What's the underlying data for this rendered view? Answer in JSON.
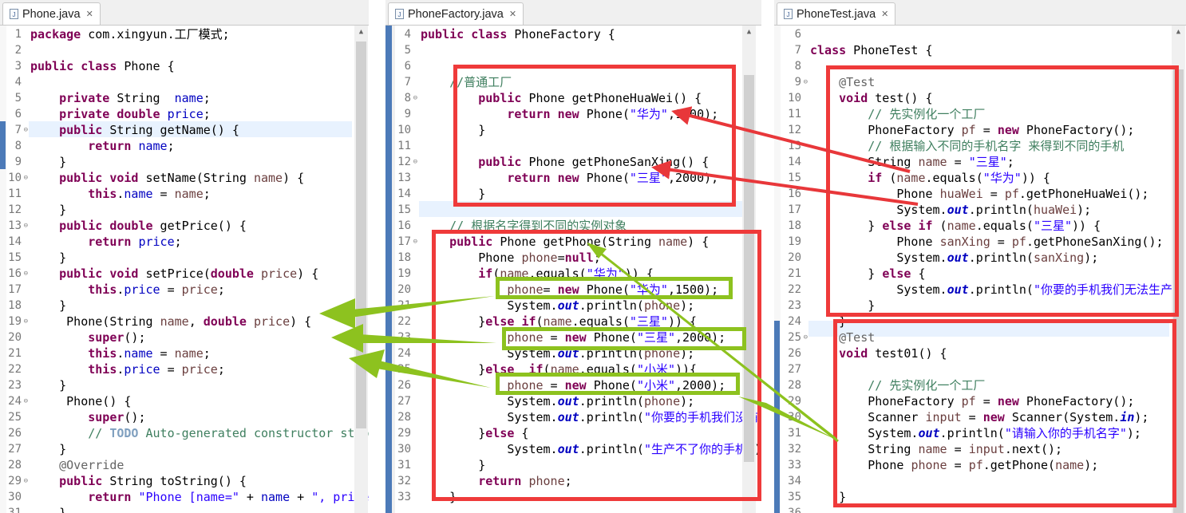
{
  "editors": [
    {
      "tab_title": "Phone.java",
      "code_lines": [
        {
          "num": "1",
          "html": "<span class=\"k\">package</span> com.xingyun.工厂模式;"
        },
        {
          "num": "2",
          "html": ""
        },
        {
          "num": "3",
          "html": "<span class=\"k\">public</span> <span class=\"k\">class</span> Phone {"
        },
        {
          "num": "4",
          "html": ""
        },
        {
          "num": "5",
          "html": "    <span class=\"k\">private</span> String  <span class=\"f\">name</span>;"
        },
        {
          "num": "6",
          "html": "    <span class=\"k\">private</span> <span class=\"k\">double</span> <span class=\"f\">price</span>;"
        },
        {
          "num": "7",
          "html": "    <span class=\"k\">public</span> String getName() {"
        },
        {
          "num": "8",
          "html": "        <span class=\"k\">return</span> <span class=\"f\">name</span>;"
        },
        {
          "num": "9",
          "html": "    }"
        },
        {
          "num": "10",
          "html": "    <span class=\"k\">public</span> <span class=\"k\">void</span> setName(String <span class=\"var\">name</span>) {"
        },
        {
          "num": "11",
          "html": "        <span class=\"k\">this</span>.<span class=\"f\">name</span> = <span class=\"var\">name</span>;"
        },
        {
          "num": "12",
          "html": "    }"
        },
        {
          "num": "13",
          "html": "    <span class=\"k\">public</span> <span class=\"k\">double</span> getPrice() {"
        },
        {
          "num": "14",
          "html": "        <span class=\"k\">return</span> <span class=\"f\">price</span>;"
        },
        {
          "num": "15",
          "html": "    }"
        },
        {
          "num": "16",
          "html": "    <span class=\"k\">public</span> <span class=\"k\">void</span> setPrice(<span class=\"k\">double</span> <span class=\"var\">price</span>) {"
        },
        {
          "num": "17",
          "html": "        <span class=\"k\">this</span>.<span class=\"f\">price</span> = <span class=\"var\">price</span>;"
        },
        {
          "num": "18",
          "html": "    }"
        },
        {
          "num": "19",
          "html": "     Phone(String <span class=\"var\">name</span>, <span class=\"k\">double</span> <span class=\"var\">price</span>) {"
        },
        {
          "num": "20",
          "html": "        <span class=\"k\">super</span>();"
        },
        {
          "num": "21",
          "html": "        <span class=\"k\">this</span>.<span class=\"f\">name</span> = <span class=\"var\">name</span>;"
        },
        {
          "num": "22",
          "html": "        <span class=\"k\">this</span>.<span class=\"f\">price</span> = <span class=\"var\">price</span>;"
        },
        {
          "num": "23",
          "html": "    }"
        },
        {
          "num": "24",
          "html": "     Phone() {"
        },
        {
          "num": "25",
          "html": "        <span class=\"k\">super</span>();"
        },
        {
          "num": "26",
          "html": "        <span class=\"c\">// <span class=\"tag\">TODO</span> Auto-generated constructor stub</span>"
        },
        {
          "num": "27",
          "html": "    }"
        },
        {
          "num": "28",
          "html": "    <span class=\"an\">@Override</span>"
        },
        {
          "num": "29",
          "html": "    <span class=\"k\">public</span> String toString() {"
        },
        {
          "num": "30",
          "html": "        <span class=\"k\">return</span> <span class=\"s\">\"Phone [name=\"</span> + <span class=\"f\">name</span> + <span class=\"s\">\", price=\"</span> + <span class=\"f\">price</span> + <span class=\"s\">\"]\"</span>;"
        },
        {
          "num": "31",
          "html": "    }"
        }
      ]
    },
    {
      "tab_title": "PhoneFactory.java",
      "code_lines": [
        {
          "num": "4",
          "html": "<span class=\"k\">public</span> <span class=\"k\">class</span> PhoneFactory {"
        },
        {
          "num": "5",
          "html": ""
        },
        {
          "num": "6",
          "html": ""
        },
        {
          "num": "7",
          "html": "    <span class=\"c\">//普通工厂</span>"
        },
        {
          "num": "8",
          "html": "        <span class=\"k\">public</span> Phone getPhoneHuaWei() {"
        },
        {
          "num": "9",
          "html": "            <span class=\"k\">return</span> <span class=\"k\">new</span> Phone(<span class=\"s\">\"华为\"</span>,1500);"
        },
        {
          "num": "10",
          "html": "        }"
        },
        {
          "num": "11",
          "html": ""
        },
        {
          "num": "12",
          "html": "        <span class=\"k\">public</span> Phone getPhoneSanXing() {"
        },
        {
          "num": "13",
          "html": "            <span class=\"k\">return</span> <span class=\"k\">new</span> Phone(<span class=\"s\">\"三星\"</span>,2000);"
        },
        {
          "num": "14",
          "html": "        }"
        },
        {
          "num": "15",
          "html": ""
        },
        {
          "num": "16",
          "html": "    <span class=\"c\">// 根据名字得到不同的实例对象</span>"
        },
        {
          "num": "17",
          "html": "    <span class=\"k\">public</span> Phone getPhone(String <span class=\"var\">name</span>) {"
        },
        {
          "num": "18",
          "html": "        Phone <span class=\"var\">phone</span>=<span class=\"k\">null</span>;"
        },
        {
          "num": "19",
          "html": "        <span class=\"k\">if</span>(<span class=\"var\">name</span>.equals(<span class=\"s\">\"华为\"</span>)) {"
        },
        {
          "num": "20",
          "html": "            <span class=\"var\">phone</span>= <span class=\"k\">new</span> Phone(<span class=\"s\">\"华为\"</span>,1500);"
        },
        {
          "num": "21",
          "html": "            System.<span class=\"so\">out</span>.println(<span class=\"var\">phone</span>);"
        },
        {
          "num": "22",
          "html": "        }<span class=\"k\">else</span> <span class=\"k\">if</span>(<span class=\"var\">name</span>.equals(<span class=\"s\">\"三星\"</span>)) {"
        },
        {
          "num": "23",
          "html": "            <span class=\"var\">phone</span> = <span class=\"k\">new</span> Phone(<span class=\"s\">\"三星\"</span>,2000);"
        },
        {
          "num": "24",
          "html": "            System.<span class=\"so\">out</span>.println(<span class=\"var\">phone</span>);"
        },
        {
          "num": "25",
          "html": "        }<span class=\"k\">else</span>  <span class=\"k\">if</span>(<span class=\"var\">name</span>.equals(<span class=\"s\">\"小米\"</span>)){"
        },
        {
          "num": "26",
          "html": "            <span class=\"var\">phone</span> = <span class=\"k\">new</span> Phone(<span class=\"s\">\"小米\"</span>,2000);"
        },
        {
          "num": "27",
          "html": "            System.<span class=\"so\">out</span>.println(<span class=\"var\">phone</span>);"
        },
        {
          "num": "28",
          "html": "            System.<span class=\"so\">out</span>.println(<span class=\"s\">\"你要的手机我们没有\"</span>);"
        },
        {
          "num": "29",
          "html": "        }<span class=\"k\">else</span> {"
        },
        {
          "num": "30",
          "html": "            System.<span class=\"so\">out</span>.println(<span class=\"s\">\"生产不了你的手机\"</span>);"
        },
        {
          "num": "31",
          "html": "        }"
        },
        {
          "num": "32",
          "html": "        <span class=\"k\">return</span> <span class=\"var\">phone</span>;"
        },
        {
          "num": "33",
          "html": "    }"
        }
      ]
    },
    {
      "tab_title": "PhoneTest.java",
      "code_lines": [
        {
          "num": "6",
          "html": ""
        },
        {
          "num": "7",
          "html": "<span class=\"k\">class</span> PhoneTest {"
        },
        {
          "num": "8",
          "html": ""
        },
        {
          "num": "9",
          "html": "    <span class=\"an\">@Test</span>"
        },
        {
          "num": "10",
          "html": "    <span class=\"k\">void</span> test() {"
        },
        {
          "num": "11",
          "html": "        <span class=\"c\">// 先实例化一个工厂</span>"
        },
        {
          "num": "12",
          "html": "        PhoneFactory <span class=\"var\">pf</span> = <span class=\"k\">new</span> PhoneFactory();"
        },
        {
          "num": "13",
          "html": "        <span class=\"c\">// 根据输入不同的手机名字 来得到不同的手机</span>"
        },
        {
          "num": "14",
          "html": "        String <span class=\"var\">name</span> = <span class=\"s\">\"三星\"</span>;"
        },
        {
          "num": "15",
          "html": "        <span class=\"k\">if</span> (<span class=\"var\">name</span>.equals(<span class=\"s\">\"华为\"</span>)) {"
        },
        {
          "num": "16",
          "html": "            Phone <span class=\"var\">huaWei</span> = <span class=\"var\">pf</span>.getPhoneHuaWei();"
        },
        {
          "num": "17",
          "html": "            System.<span class=\"so\">out</span>.println(<span class=\"var\">huaWei</span>);"
        },
        {
          "num": "18",
          "html": "        } <span class=\"k\">else</span> <span class=\"k\">if</span> (<span class=\"var\">name</span>.equals(<span class=\"s\">\"三星\"</span>)) {"
        },
        {
          "num": "19",
          "html": "            Phone <span class=\"var\">sanXing</span> = <span class=\"var\">pf</span>.getPhoneSanXing();"
        },
        {
          "num": "20",
          "html": "            System.<span class=\"so\">out</span>.println(<span class=\"var\">sanXing</span>);"
        },
        {
          "num": "21",
          "html": "        } <span class=\"k\">else</span> {"
        },
        {
          "num": "22",
          "html": "            System.<span class=\"so\">out</span>.println(<span class=\"s\">\"你要的手机我们无法生产\"</span>);"
        },
        {
          "num": "23",
          "html": "        }"
        },
        {
          "num": "24",
          "html": "    }"
        },
        {
          "num": "25",
          "html": "    <span class=\"an\">@Test</span>"
        },
        {
          "num": "26",
          "html": "    <span class=\"k\">void</span> test01() {"
        },
        {
          "num": "27",
          "html": ""
        },
        {
          "num": "28",
          "html": "        <span class=\"c\">// 先实例化一个工厂</span>"
        },
        {
          "num": "29",
          "html": "        PhoneFactory <span class=\"var\">pf</span> = <span class=\"k\">new</span> PhoneFactory();"
        },
        {
          "num": "30",
          "html": "        Scanner <span class=\"var\">input</span> = <span class=\"k\">new</span> Scanner(System.<span class=\"so\">in</span>);"
        },
        {
          "num": "31",
          "html": "        System.<span class=\"so\">out</span>.println(<span class=\"s\">\"请输入你的手机名字\"</span>);"
        },
        {
          "num": "32",
          "html": "        String <span class=\"var\">name</span> = <span class=\"var\">input</span>.next();"
        },
        {
          "num": "33",
          "html": "        Phone <span class=\"var\">phone</span> = <span class=\"var\">pf</span>.getPhone(<span class=\"var\">name</span>);"
        },
        {
          "num": "34",
          "html": ""
        },
        {
          "num": "35",
          "html": "    }"
        },
        {
          "num": "36",
          "html": ""
        }
      ]
    }
  ],
  "annotation_colors": {
    "red_box": "#ef3a3a",
    "green_box": "#8dc21f",
    "red_arrow": "#e8373a",
    "green_arrow": "#8dc21f"
  }
}
